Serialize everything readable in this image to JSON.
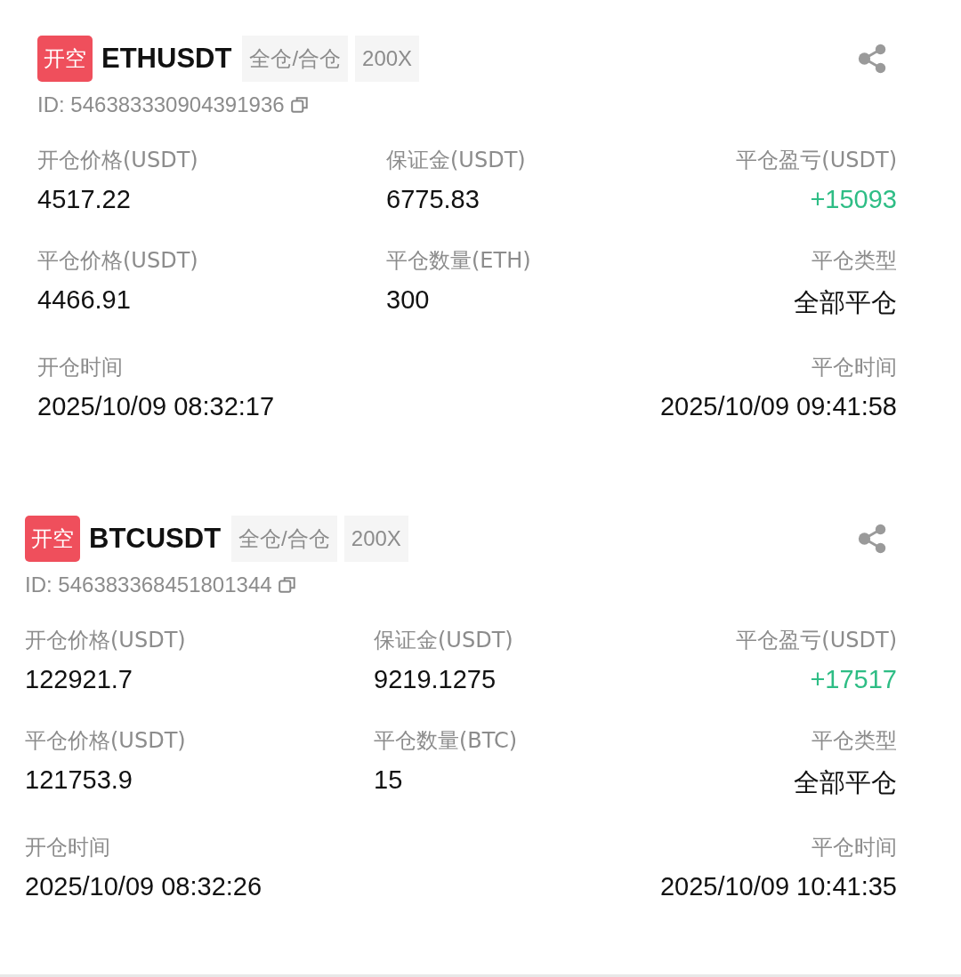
{
  "orders": [
    {
      "kind": "short",
      "side_label": "开空",
      "symbol": "ETHUSDT",
      "tags": [
        "全仓/合仓",
        "200X"
      ],
      "id": "ID: 546383330904391936",
      "rows": [
        {
          "left": {
            "label": "开仓价格(USDT)",
            "value": "4517.22"
          },
          "middle": {
            "label": "保证金(USDT)",
            "value": "6775.83"
          },
          "right": {
            "label": "平仓盈亏(USDT)",
            "value": "+15093",
            "kind": "profit"
          }
        },
        {
          "left": {
            "label": "平仓价格(USDT)",
            "value": "4466.91"
          },
          "middle": {
            "label": "平仓数量(ETH)",
            "value": "300"
          },
          "right": {
            "label": "平仓类型",
            "value": "全部平仓"
          }
        },
        {
          "left": {
            "label": "开仓时间",
            "value": "2025/10/09 08:32:17"
          },
          "right": {
            "label": "平仓时间",
            "value": "2025/10/09 09:41:58"
          }
        }
      ]
    },
    {
      "kind": "short",
      "side_label": "开空",
      "symbol": "BTCUSDT",
      "tags": [
        "全仓/合仓",
        "200X"
      ],
      "id": "ID: 546383368451801344",
      "rows": [
        {
          "left": {
            "label": "开仓价格(USDT)",
            "value": "122921.7"
          },
          "middle": {
            "label": "保证金(USDT)",
            "value": "9219.1275"
          },
          "right": {
            "label": "平仓盈亏(USDT)",
            "value": "+17517",
            "kind": "profit"
          }
        },
        {
          "left": {
            "label": "平仓价格(USDT)",
            "value": "121753.9"
          },
          "middle": {
            "label": "平仓数量(BTC)",
            "value": "15"
          },
          "right": {
            "label": "平仓类型",
            "value": "全部平仓"
          }
        },
        {
          "left": {
            "label": "开仓时间",
            "value": "2025/10/09 08:32:26"
          },
          "right": {
            "label": "平仓时间",
            "value": "2025/10/09 10:41:35"
          }
        }
      ]
    }
  ]
}
